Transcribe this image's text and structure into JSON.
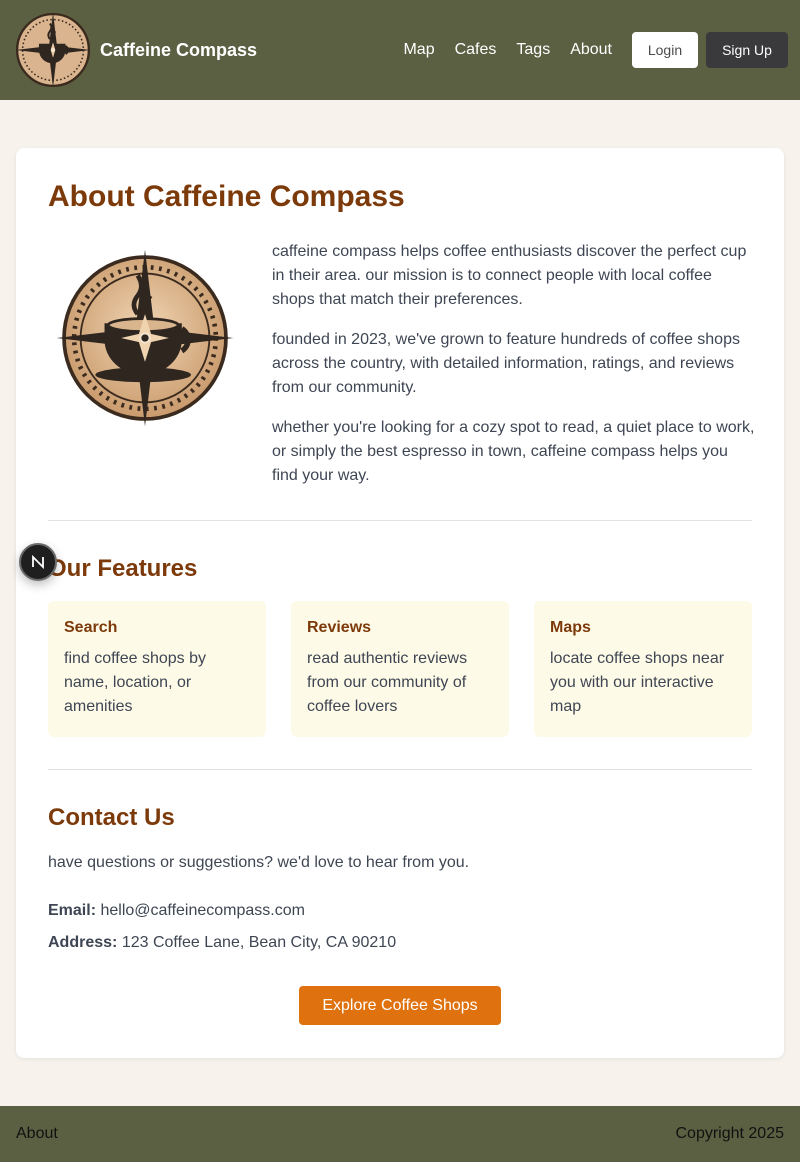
{
  "header": {
    "brand": "Caffeine Compass",
    "nav": [
      "Map",
      "Cafes",
      "Tags",
      "About"
    ],
    "login": "Login",
    "signup": "Sign Up"
  },
  "about": {
    "title": "About Caffeine Compass",
    "paragraphs": [
      "caffeine compass helps coffee enthusiasts discover the perfect cup in their area. our mission is to connect people with local coffee shops that match their preferences.",
      "founded in 2023, we've grown to feature hundreds of coffee shops across the country, with detailed information, ratings, and reviews from our community.",
      "whether you're looking for a cozy spot to read, a quiet place to work, or simply the best espresso in town, caffeine compass helps you find your way."
    ]
  },
  "features": {
    "title": "Our Features",
    "items": [
      {
        "title": "Search",
        "desc": "find coffee shops by name, location, or amenities"
      },
      {
        "title": "Reviews",
        "desc": "read authentic reviews from our community of coffee lovers"
      },
      {
        "title": "Maps",
        "desc": "locate coffee shops near you with our interactive map"
      }
    ]
  },
  "contact": {
    "title": "Contact Us",
    "intro": "have questions or suggestions? we'd love to hear from you.",
    "email_label": "Email:",
    "email": "hello@caffeinecompass.com",
    "address_label": "Address:",
    "address": "123 Coffee Lane, Bean City, CA 90210",
    "cta": "Explore Coffee Shops"
  },
  "badge": {
    "letter": "N"
  },
  "footer": {
    "left": "About",
    "right": "Copyright 2025"
  },
  "colors": {
    "header_bg": "#5b6042",
    "heading": "#7c3a0a",
    "accent": "#df720f",
    "feature_bg": "#fefae8",
    "page_bg": "#f7f3ec"
  }
}
